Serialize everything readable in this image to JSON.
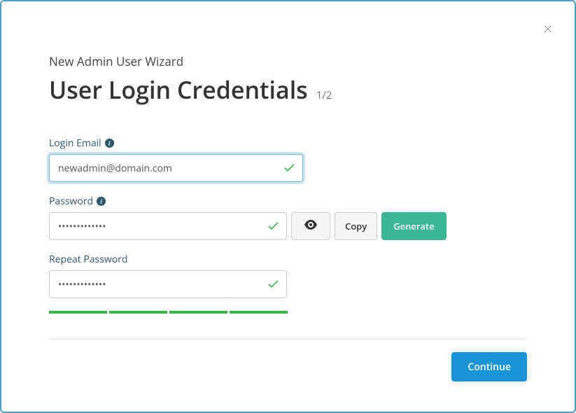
{
  "wizard": {
    "subtitle": "New Admin User Wizard",
    "title": "User Login Credentials",
    "step": "1/2"
  },
  "fields": {
    "email_label": "Login Email",
    "email_value": "newadmin@domain.com",
    "password_label": "Password",
    "password_value": "•••••••••••••",
    "repeat_label": "Repeat Password",
    "repeat_value": "•••••••••••••"
  },
  "buttons": {
    "copy": "Copy",
    "generate": "Generate",
    "continue": "Continue"
  }
}
